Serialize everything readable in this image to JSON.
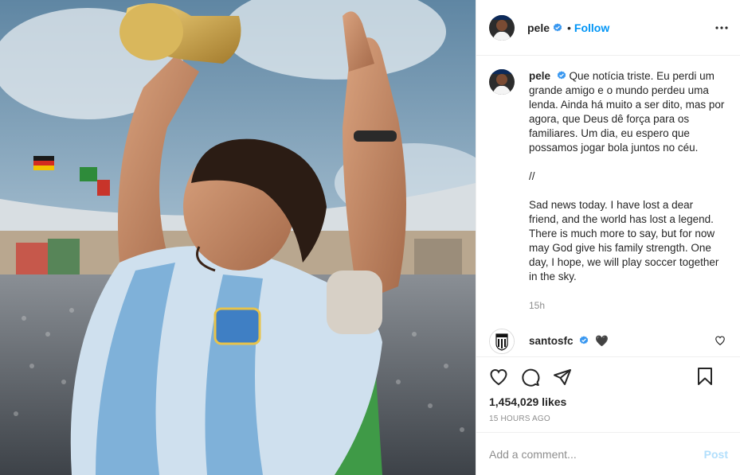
{
  "post": {
    "username": "pele",
    "follow_label": "Follow",
    "dot": "•"
  },
  "caption": {
    "username": "pele",
    "paragraphs": [
      "Que notícia triste. Eu perdi um grande amigo e o mundo perdeu uma lenda. Ainda há muito a ser dito, mas por agora, que Deus dê força para os familiares. Um dia, eu espero que possamos jogar bola juntos no céu.",
      "//",
      "Sad news today. I have lost a dear friend, and the world has lost a legend. There is much more to say, but for now may God give his family strength. One day, I hope, we will play soccer together in the sky."
    ],
    "time": "15h"
  },
  "comment": {
    "username": "santosfc",
    "emoji": "🖤"
  },
  "engagement": {
    "likes": "1,454,029 likes",
    "posted_ago": "15 HOURS AGO"
  },
  "composer": {
    "placeholder": "Add a comment...",
    "post_label": "Post"
  },
  "colors": {
    "accent": "#0095f6",
    "post_disabled": "#b2dffc",
    "text": "#262626",
    "muted": "#8e8e8e",
    "border": "#efefef"
  },
  "icons": {
    "verified": "verified-badge-icon",
    "more": "more-options-icon",
    "like": "heart-icon",
    "comment": "comment-icon",
    "share": "share-icon",
    "save": "bookmark-icon"
  }
}
